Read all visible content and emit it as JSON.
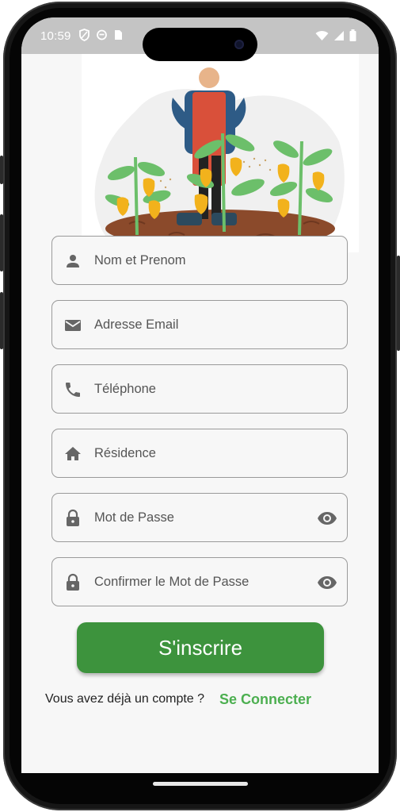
{
  "status_bar": {
    "time": "10:59",
    "left_icons": [
      "shield-icon",
      "sync-icon",
      "sim-card-icon"
    ],
    "right_icons": [
      "wifi-icon",
      "signal-icon",
      "battery-icon"
    ]
  },
  "illustration": {
    "subject": "farmer-with-pepper-plants",
    "colors": {
      "soil": "#8b4a2b",
      "pepper": "#f2b21c",
      "leaf": "#6cbf6a",
      "apron": "#d9503a",
      "shirt": "#2e5b86"
    }
  },
  "form": {
    "fields": [
      {
        "icon": "person-icon",
        "placeholder": "Nom et Prenom"
      },
      {
        "icon": "email-icon",
        "placeholder": "Adresse Email"
      },
      {
        "icon": "phone-icon",
        "placeholder": "Téléphone"
      },
      {
        "icon": "home-icon",
        "placeholder": "Résidence"
      },
      {
        "icon": "lock-icon",
        "placeholder": "Mot de Passe",
        "toggle_icon": "eye-icon"
      },
      {
        "icon": "lock-icon",
        "placeholder": "Confirmer le Mot de Passe",
        "toggle_icon": "eye-icon"
      }
    ],
    "submit_label": "S'inscrire"
  },
  "footer": {
    "prompt": "Vous avez déjà un compte ?",
    "link_label": "Se Connecter"
  },
  "colors": {
    "primary": "#3d933d",
    "link": "#4caf50",
    "field_border": "#9a9a9a",
    "icon": "#666666"
  }
}
